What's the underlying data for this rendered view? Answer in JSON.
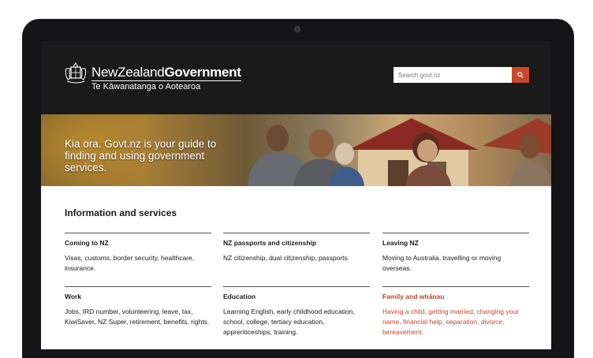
{
  "header": {
    "title_part1": "New",
    "title_part2": "Zealand",
    "title_part3": "Government",
    "subtitle": "Te Kāwanatanga o Aotearoa",
    "search_placeholder": "Search govt.nz",
    "search_icon": "search-icon"
  },
  "hero": {
    "text": "Kia ora. Govt.nz is your guide to finding and using government services."
  },
  "main": {
    "section_title": "Information and services",
    "cards": [
      {
        "title": "Coming to NZ",
        "desc": "Visas, customs, border security, healthcare, insurance."
      },
      {
        "title": "NZ passports and citizenship",
        "desc": "NZ citizenship, dual citizenship, passports."
      },
      {
        "title": "Leaving NZ",
        "desc": "Moving to Australia, travelling or moving overseas."
      },
      {
        "title": "Work",
        "desc": "Jobs, IRD number, volunteering, leave, tax, KiwiSaver, NZ Super, retirement, benefits, rights."
      },
      {
        "title": "Education",
        "desc": "Learning English, early childhood education, school, college, tertiary education, apprenticeships, training."
      },
      {
        "title": "Family and whānau",
        "desc": "Having a child, getting married, changing your name, financial help, separation, divorce, bereavement."
      }
    ]
  },
  "colors": {
    "header_bg": "#1a1a1a",
    "accent": "#c84a2a",
    "link_red": "#c8412b"
  }
}
